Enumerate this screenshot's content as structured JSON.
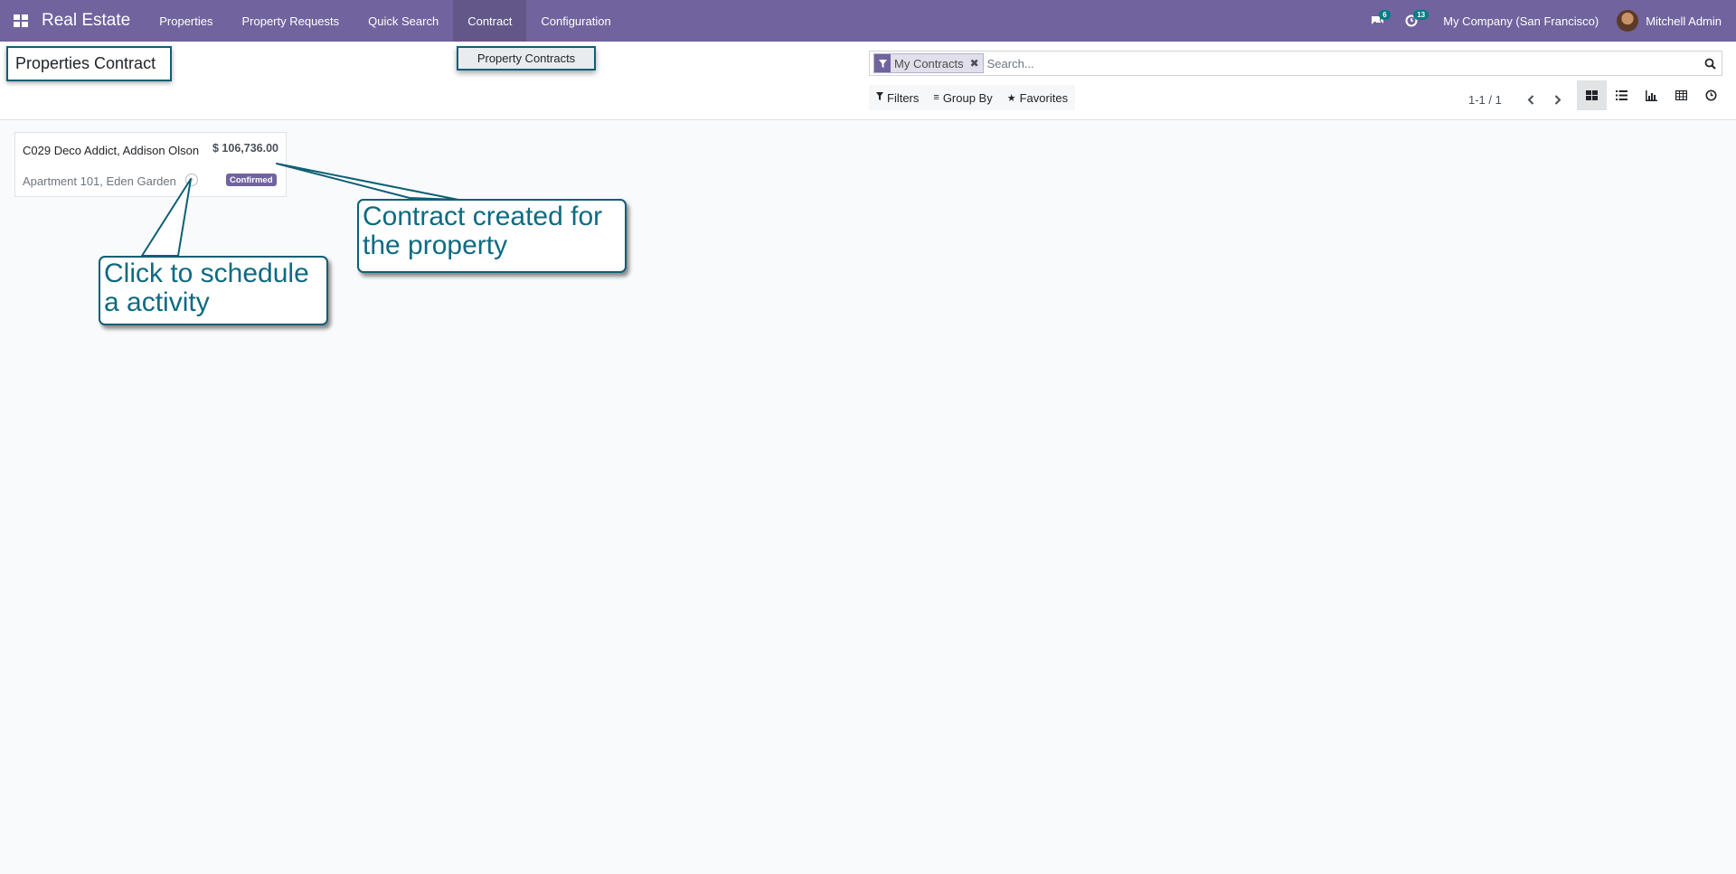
{
  "navbar": {
    "brand": "Real Estate",
    "menu": [
      "Properties",
      "Property Requests",
      "Quick Search",
      "Contract",
      "Configuration"
    ],
    "active_menu": "Contract",
    "messages_count": "6",
    "activities_count": "13",
    "company": "My Company (San Francisco)",
    "user": "Mitchell Admin"
  },
  "dropdown": {
    "items": [
      "Property Contracts"
    ]
  },
  "control_panel": {
    "title": "Properties Contract",
    "search": {
      "facet_label": "My Contracts",
      "placeholder": "Search..."
    },
    "filters": {
      "filters_label": "Filters",
      "group_by_label": "Group By",
      "favorites_label": "Favorites"
    },
    "pager": "1-1 / 1",
    "views": [
      "kanban-icon",
      "list-icon",
      "graph-icon",
      "pivot-icon",
      "activity-icon"
    ],
    "active_view": "kanban"
  },
  "kanban": {
    "cards": [
      {
        "title": "C029 Deco Addict, Addison Olson",
        "amount": "$ 106,736.00",
        "property": "Apartment 101, Eden Garden",
        "status": "Confirmed"
      }
    ]
  },
  "callouts": {
    "contract_created": "Contract created for the property",
    "schedule_activity": "Click to schedule a activity"
  },
  "colors": {
    "brand": "#71639e",
    "accent": "#017e84",
    "callout_border": "#0e5f75",
    "callout_text": "#0e6a82"
  }
}
